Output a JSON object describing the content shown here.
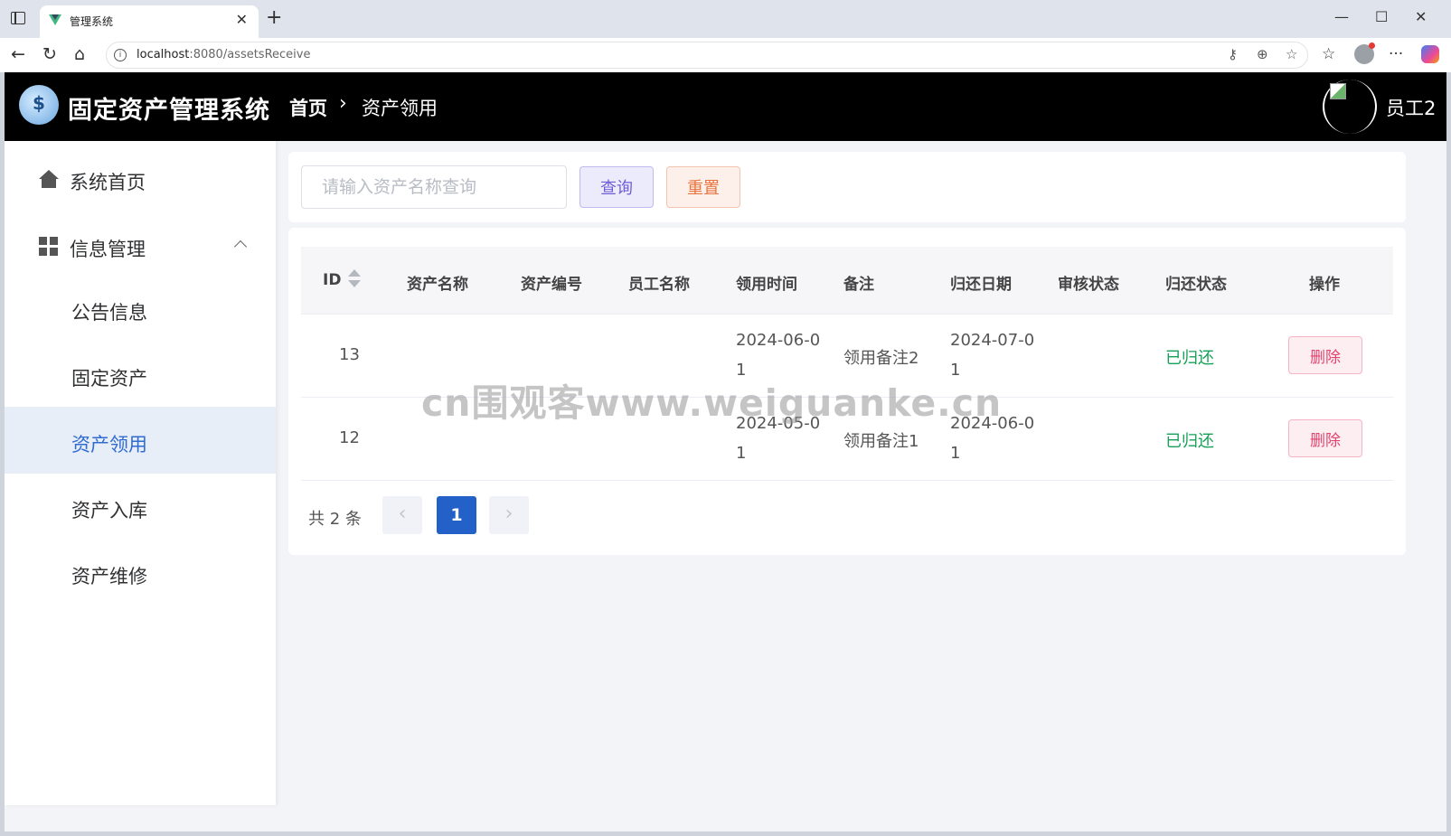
{
  "browser": {
    "tab_title": "管理系统",
    "url_host": "localhost",
    "url_rest": ":8080/assetsReceive"
  },
  "app": {
    "title": "固定资产管理系统",
    "breadcrumb": {
      "home": "首页",
      "current": "资产领用"
    },
    "user_name": "员工2"
  },
  "sidebar": {
    "items": [
      {
        "label": "系统首页",
        "icon": "home-icon"
      },
      {
        "label": "信息管理",
        "icon": "grid-icon"
      },
      {
        "label": "公告信息"
      },
      {
        "label": "固定资产"
      },
      {
        "label": "资产领用",
        "active": true
      },
      {
        "label": "资产入库"
      },
      {
        "label": "资产维修"
      }
    ]
  },
  "search": {
    "placeholder": "请输入资产名称查询",
    "query_label": "查询",
    "reset_label": "重置"
  },
  "table": {
    "columns": [
      "ID",
      "资产名称",
      "资产编号",
      "员工名称",
      "领用时间",
      "备注",
      "归还日期",
      "审核状态",
      "归还状态",
      "操作"
    ],
    "rows": [
      {
        "id": "13",
        "asset_name": "",
        "asset_no": "",
        "employee": "",
        "receive_time": "2024-06-01",
        "remark": "领用备注2",
        "return_date": "2024-07-01",
        "audit_status": "",
        "return_status": "已归还",
        "action": "删除"
      },
      {
        "id": "12",
        "asset_name": "",
        "asset_no": "",
        "employee": "",
        "receive_time": "2024-05-01",
        "remark": "领用备注1",
        "return_date": "2024-06-01",
        "audit_status": "",
        "return_status": "已归还",
        "action": "删除"
      }
    ]
  },
  "pagination": {
    "total_label": "共 2 条",
    "current_page": "1"
  },
  "watermark": "cn围观客www.weiguanke.cn",
  "colors": {
    "header_bg": "#000000",
    "accent": "#2360c8",
    "success": "#18a058",
    "danger": "#e0446f"
  }
}
